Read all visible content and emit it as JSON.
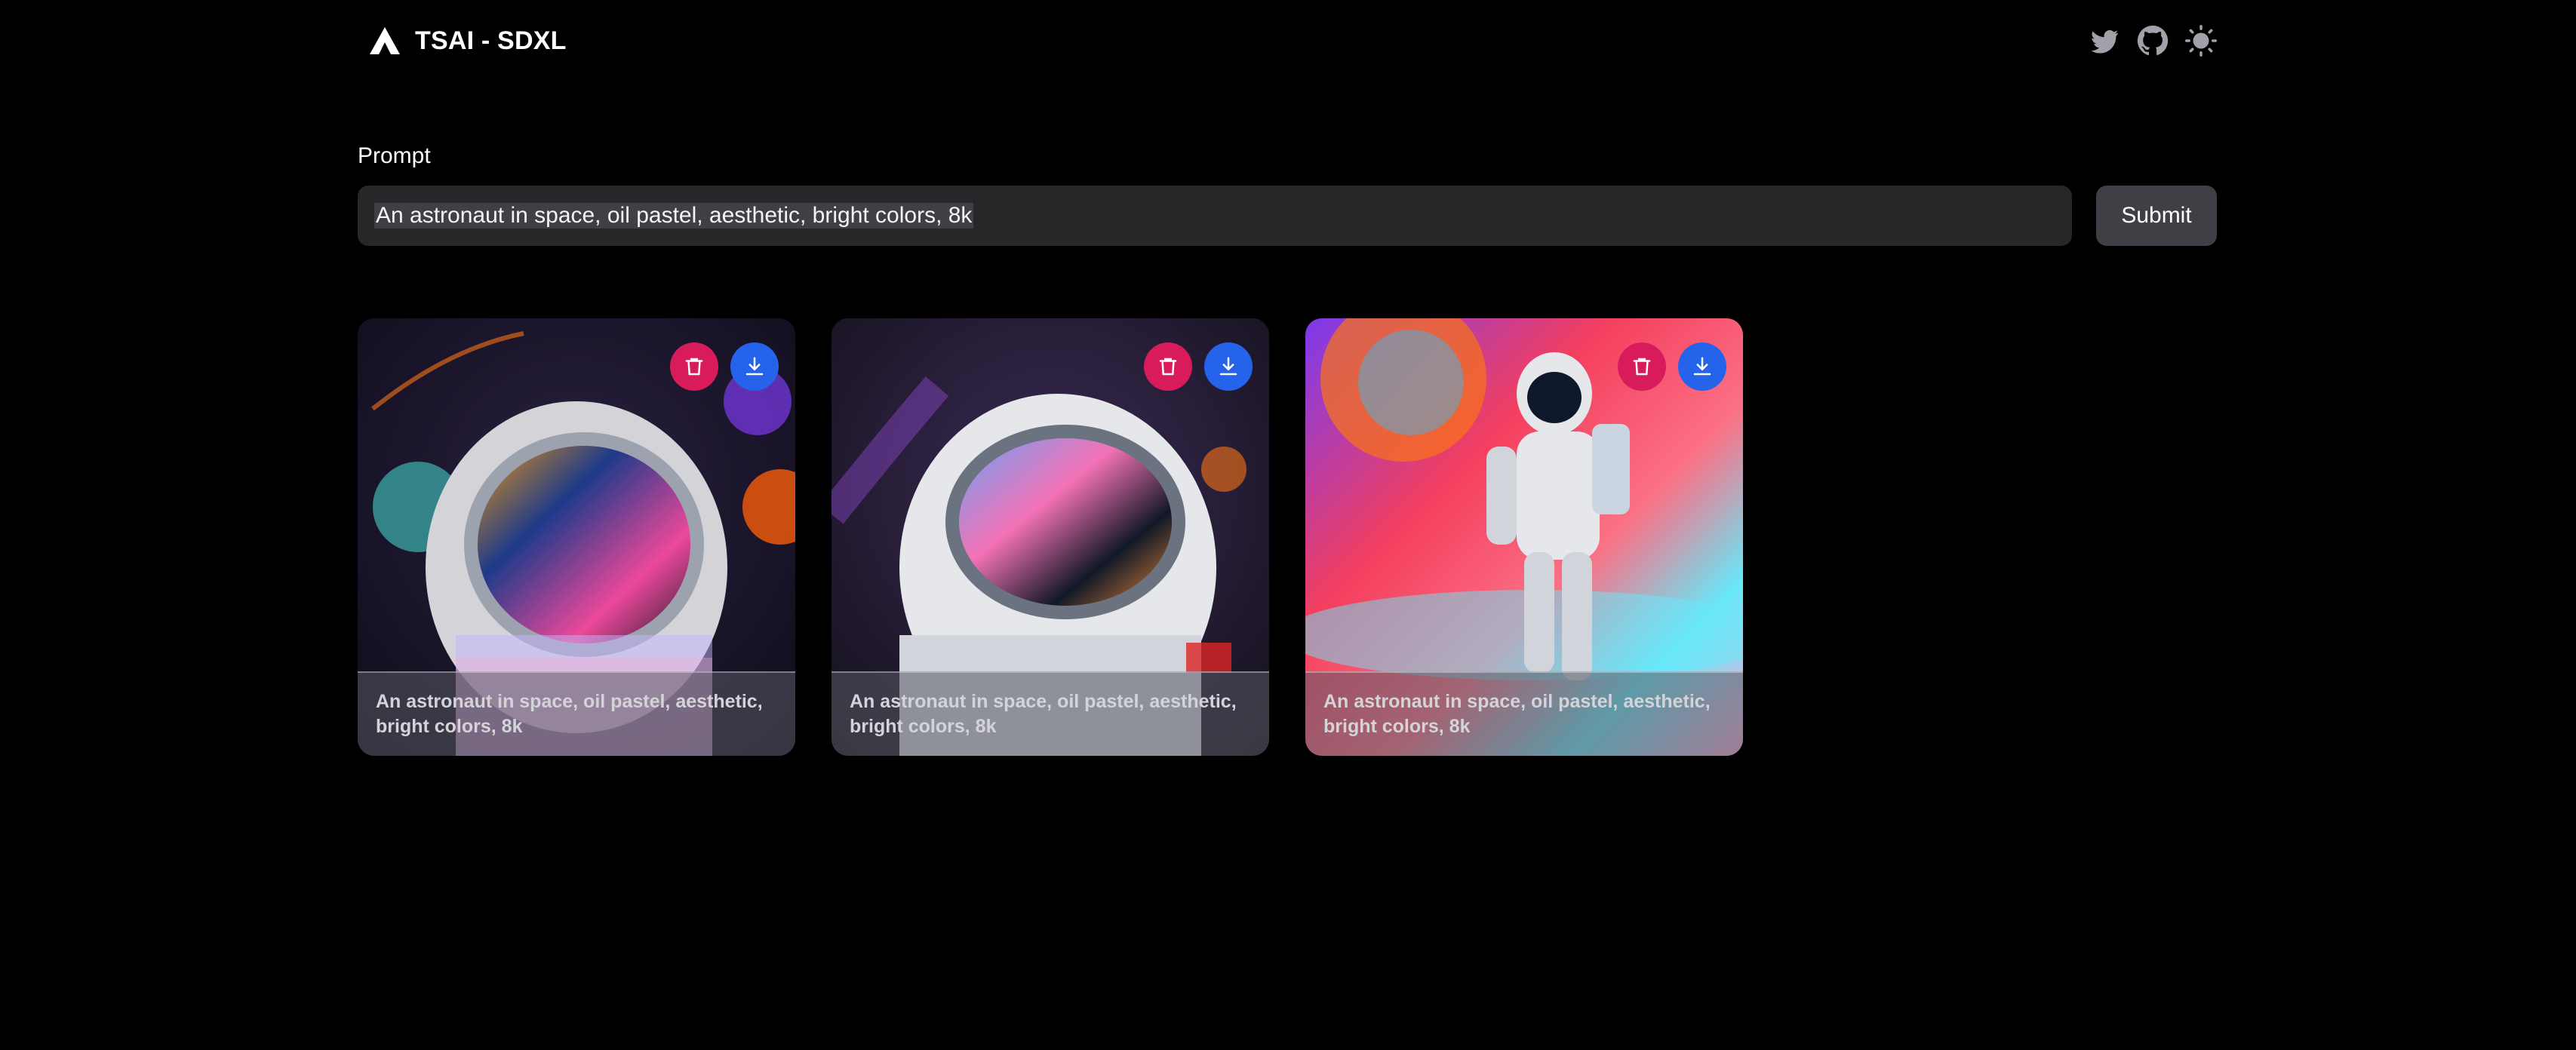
{
  "header": {
    "title": "TSAI - SDXL",
    "icons": [
      "logo-icon",
      "twitter-icon",
      "github-icon",
      "theme-toggle-icon"
    ]
  },
  "prompt": {
    "label": "Prompt",
    "value": "An astronaut in space, oil pastel, aesthetic, bright colors, 8k",
    "submit_label": "Submit"
  },
  "gallery": {
    "cards": [
      {
        "caption": "An astronaut in space, oil pastel, aesthetic, bright colors, 8k"
      },
      {
        "caption": "An astronaut in space, oil pastel, aesthetic, bright colors, 8k"
      },
      {
        "caption": "An astronaut in space, oil pastel, aesthetic, bright colors, 8k"
      }
    ]
  },
  "colors": {
    "background": "#000000",
    "input_bg": "#27272a",
    "button_bg": "#3f3f46",
    "delete": "#d81b5a",
    "download": "#2563eb"
  }
}
